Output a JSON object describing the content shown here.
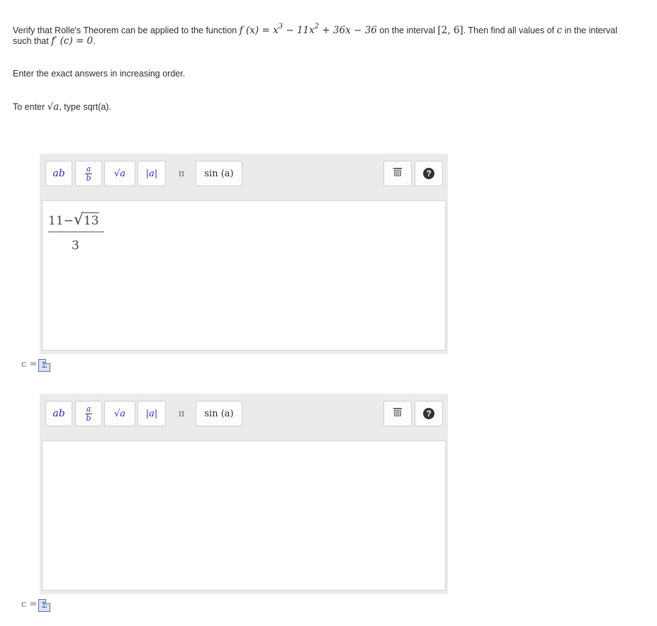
{
  "question": {
    "line1_prefix": "Verify that Rolle's Theorem can be applied to the function",
    "func_lhs": "f (x) = x",
    "func_exp1": "3",
    "func_mid": " − 11x",
    "func_exp2": "2",
    "func_rest": " + 36x − 36",
    "line1_interval_pre": "on the interval",
    "interval": "[2, 6]",
    "line1_suffix": ". Then find all values of",
    "var_c": "c",
    "line1_end": "in the interval",
    "line2_prefix": "such that",
    "line2_math": "f′ (c) = 0",
    "line2_end": "."
  },
  "instructions": {
    "order": "Enter the exact answers in increasing order.",
    "sqrt_prefix": "To enter",
    "sqrt_math": "√a",
    "sqrt_suffix": ", type sqrt(a)."
  },
  "toolbar": {
    "power_base": "a",
    "power_exp": "b",
    "frac_num": "a",
    "frac_den": "b",
    "sqrt_label": "√a",
    "abs_label": "|a|",
    "pi_label": "π",
    "sin_label": "sin (a)",
    "trash_icon": "trash-icon",
    "help_icon": "help-icon",
    "help_glyph": "?"
  },
  "answers": [
    {
      "label": "c =",
      "value_numerator_left": "11−",
      "value_numerator_radicand": "13",
      "value_denominator": "3"
    },
    {
      "label": "c =",
      "value_numerator_left": "",
      "value_numerator_radicand": "",
      "value_denominator": ""
    }
  ],
  "sigma_glyph": "Σ"
}
